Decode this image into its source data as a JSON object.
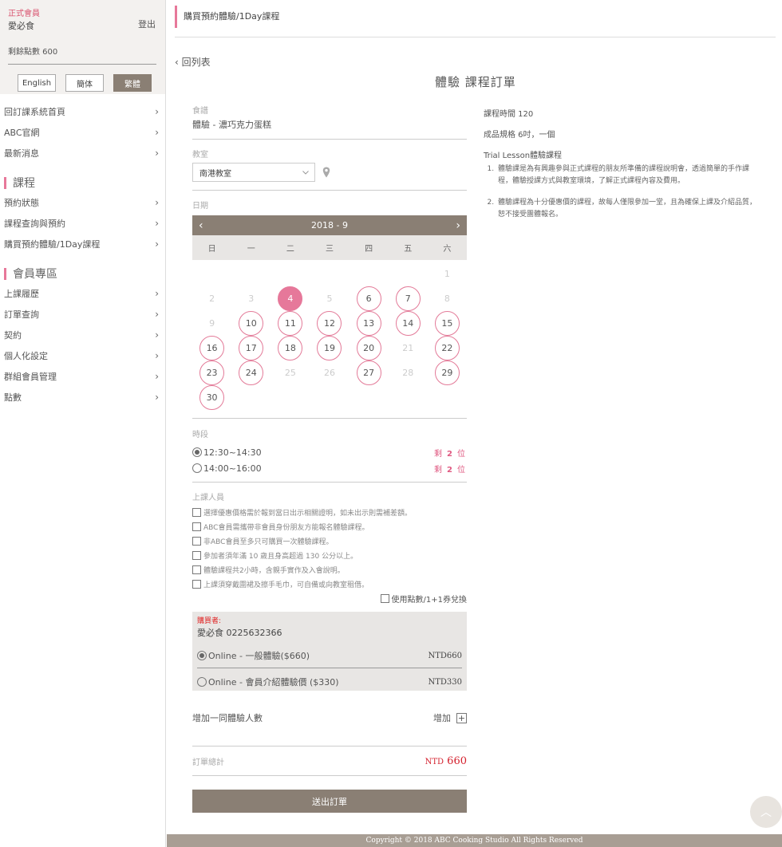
{
  "sidebar": {
    "member_label": "正式會員",
    "member_name": "愛必食",
    "logout": "登出",
    "points": "剩餘點數 600",
    "languages": [
      "English",
      "簡体",
      "繁體"
    ],
    "nav_top": [
      "回訂課系統首頁",
      "ABC官網",
      "最新消息"
    ],
    "section_course": "課程",
    "nav_course": [
      "預約狀態",
      "課程查詢與預約",
      "購買預約體驗/1Day課程"
    ],
    "section_member": "會員專區",
    "nav_member": [
      "上課履歷",
      "訂單查詢",
      "契約",
      "個人化設定",
      "群組會員管理",
      "點數"
    ],
    "chevron": "›"
  },
  "header": {
    "breadcrumb": "購買預約體驗/1Day課程",
    "back": "‹ 回列表",
    "title": "體驗 課程訂單"
  },
  "form": {
    "recipe_label": "食譜",
    "recipe_value": "體驗 - 濃巧克力蛋糕",
    "classroom_label": "教室",
    "classroom_value": "南港教室",
    "date_label": "日期",
    "slot_label": "時段",
    "attendee_label": "上課人員",
    "add_label": "增加一同體驗人數",
    "add_action": "增加",
    "plus": "+",
    "total_label": "訂單總計",
    "total_currency": "NTD",
    "total_value": "660",
    "submit": "送出訂單"
  },
  "calendar": {
    "prev": "‹",
    "next": "›",
    "month": "2018 - 9",
    "weekdays": [
      "日",
      "一",
      "二",
      "三",
      "四",
      "五",
      "六"
    ],
    "selected": 4,
    "available": [
      6,
      7,
      10,
      11,
      12,
      13,
      14,
      15,
      16,
      17,
      18,
      19,
      20,
      22,
      23,
      24,
      27,
      29,
      30
    ],
    "first_weekday": 6,
    "days": 30
  },
  "slots": [
    {
      "time": "12:30~14:30",
      "prefix": "剩",
      "count": "2",
      "suffix": "位",
      "selected": true
    },
    {
      "time": "14:00~16:00",
      "prefix": "剩",
      "count": "2",
      "suffix": "位",
      "selected": false
    }
  ],
  "notices": [
    "選擇優惠價格需於報到當日出示相關證明，如未出示則需補差額。",
    "ABC會員需攜帶非會員身份朋友方能報名體驗課程。",
    "非ABC會員至多只可購買一次體驗課程。",
    "參加者須年滿 10 歲且身高超過 130 公分以上。",
    "體驗課程共2小時，含親手實作及入會說明。",
    "上課須穿戴圍裙及擦手毛巾，可自備或向教室租借。"
  ],
  "points_option": "使用點數/1+1券兌換",
  "buyer": {
    "label": "購買者:",
    "name": "愛必食 0225632366",
    "options": [
      {
        "label": "Online - 一般體驗($660)",
        "price": "NTD660",
        "selected": true
      },
      {
        "label": "Online - 會員介紹體驗價 ($330)",
        "price": "NTD330",
        "selected": false
      }
    ]
  },
  "info": {
    "duration": "課程時間  120",
    "spec": "成品規格  6吋，一個",
    "heading": "Trial Lesson體驗課程",
    "items": [
      "體驗課是為有興趣參與正式課程的朋友所準備的課程說明會，透過簡單的手作課程，體驗授課方式與教室環境，了解正式課程內容及費用。",
      "體驗課程為十分優惠價的課程，故每人僅限參加一堂，且為確保上課及介紹品質，恕不接受團體報名。"
    ]
  },
  "footer": "Copyright © 2018 ABC Cooking Studio All Rights Reserved",
  "top_button": "︿"
}
